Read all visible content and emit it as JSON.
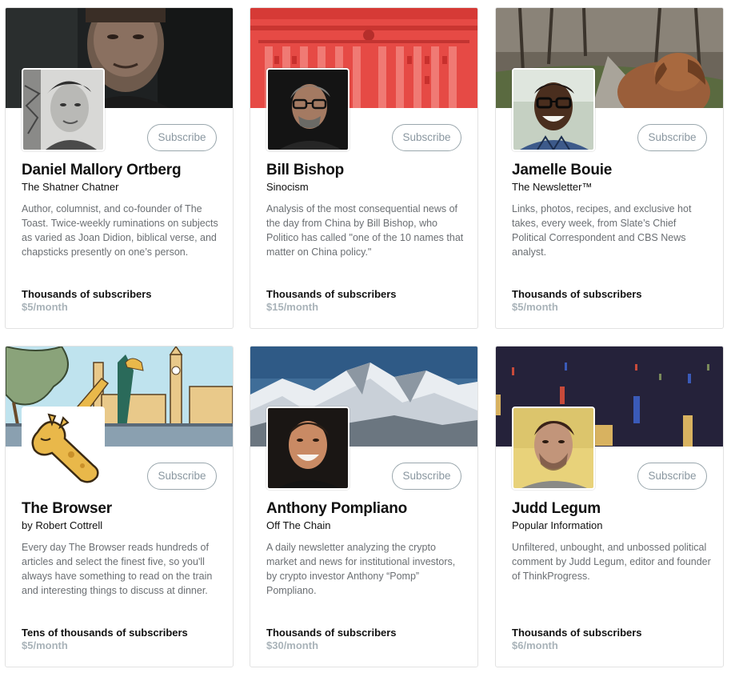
{
  "cards": [
    {
      "name": "Daniel Mallory Ortberg",
      "publication": "The Shatner Chatner",
      "description": "Author, columnist, and co-founder of The Toast. Twice-weekly ruminations on subjects as varied as Joan Didion, biblical verse, and chapsticks presently on one’s person.",
      "subscribers": "Thousands of subscribers",
      "price": "$5/month",
      "subscribe_label": "Subscribe"
    },
    {
      "name": "Bill Bishop",
      "publication": "Sinocism",
      "description": "Analysis of the most consequential news of the day from China by Bill Bishop, who Politico has called \"one of the 10 names that matter on China policy.\"",
      "subscribers": "Thousands of subscribers",
      "price": "$15/month",
      "subscribe_label": "Subscribe"
    },
    {
      "name": "Jamelle Bouie",
      "publication": "The Newsletter™",
      "description": "Links, photos, recipes, and exclusive hot takes, every week, from Slate’s Chief Political Correspondent and CBS News analyst.",
      "subscribers": "Thousands of subscribers",
      "price": "$5/month",
      "subscribe_label": "Subscribe"
    },
    {
      "name": "The Browser",
      "publication": "by Robert Cottrell",
      "description": "Every day The Browser reads hundreds of articles and select the finest five, so you'll always have something to read on the train and interesting things to discuss at dinner.",
      "subscribers": "Tens of thousands of subscribers",
      "price": "$5/month",
      "subscribe_label": "Subscribe"
    },
    {
      "name": "Anthony Pompliano",
      "publication": "Off The Chain",
      "description": "A daily newsletter analyzing the crypto market and news for institutional investors, by crypto investor Anthony “Pomp” Pompliano.",
      "subscribers": "Thousands of subscribers",
      "price": "$30/month",
      "subscribe_label": "Subscribe"
    },
    {
      "name": "Judd Legum",
      "publication": "Popular Information",
      "description": "Unfiltered, unbought, and unbossed political comment by Judd Legum, editor and founder of ThinkProgress.",
      "subscribers": "Thousands of subscribers",
      "price": "$6/month",
      "subscribe_label": "Subscribe"
    }
  ],
  "icons": {
    "banner_images": [
      "banner-portrait-dark",
      "banner-building-red",
      "banner-forest-dog",
      "banner-london-giraffe",
      "banner-mountains",
      "banner-pillars-dark"
    ],
    "avatars": [
      "avatar-photo",
      "avatar-photo",
      "avatar-photo",
      "giraffe-logo-icon",
      "avatar-photo",
      "avatar-photo"
    ]
  },
  "colors": {
    "subscribe_border": "#9aa7ad",
    "price_text": "#a9b3b9",
    "description_text": "#6b6f73"
  }
}
